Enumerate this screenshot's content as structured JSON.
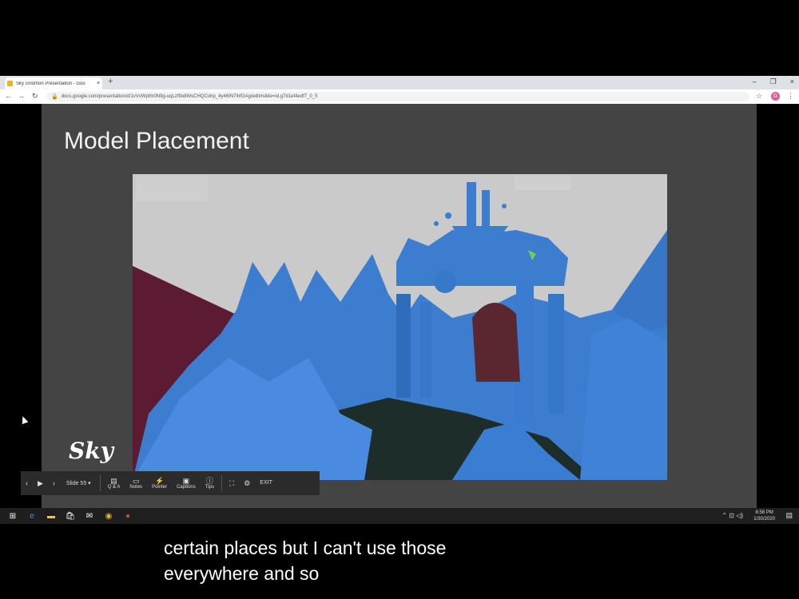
{
  "browser": {
    "tab_title": "Sky Gnomon Presentation - Goo",
    "tab_close": "×",
    "new_tab": "+",
    "window_controls": [
      "–",
      "❐",
      "×"
    ],
    "url": "docs.google.com/presentation/d/1vVvWpfm0N9g-uqLzf9o8WsCHQCohp_4y46IN7ihfGAg/edit#slide=id.g7d1ef4edf7_0_5",
    "avatar_letter": "G"
  },
  "slide": {
    "title": "Model Placement",
    "logo_text": "Sky"
  },
  "toolbar": {
    "slide_label": "Slide 55",
    "buttons": [
      "Q & A",
      "Notes",
      "Pointer",
      "Captions",
      "Tips"
    ],
    "exit_label": "EXIT"
  },
  "taskbar": {
    "time": "8:58 PM",
    "date": "1/30/2020"
  },
  "caption": {
    "line1": "certain places but I can't use those",
    "line2": "everywhere and so"
  },
  "colors": {
    "scene_sky": "#cacaca",
    "terrain_blue": "#3c7dd0",
    "terrain_dark": "#1d3557",
    "maroon": "#5c1a33"
  }
}
